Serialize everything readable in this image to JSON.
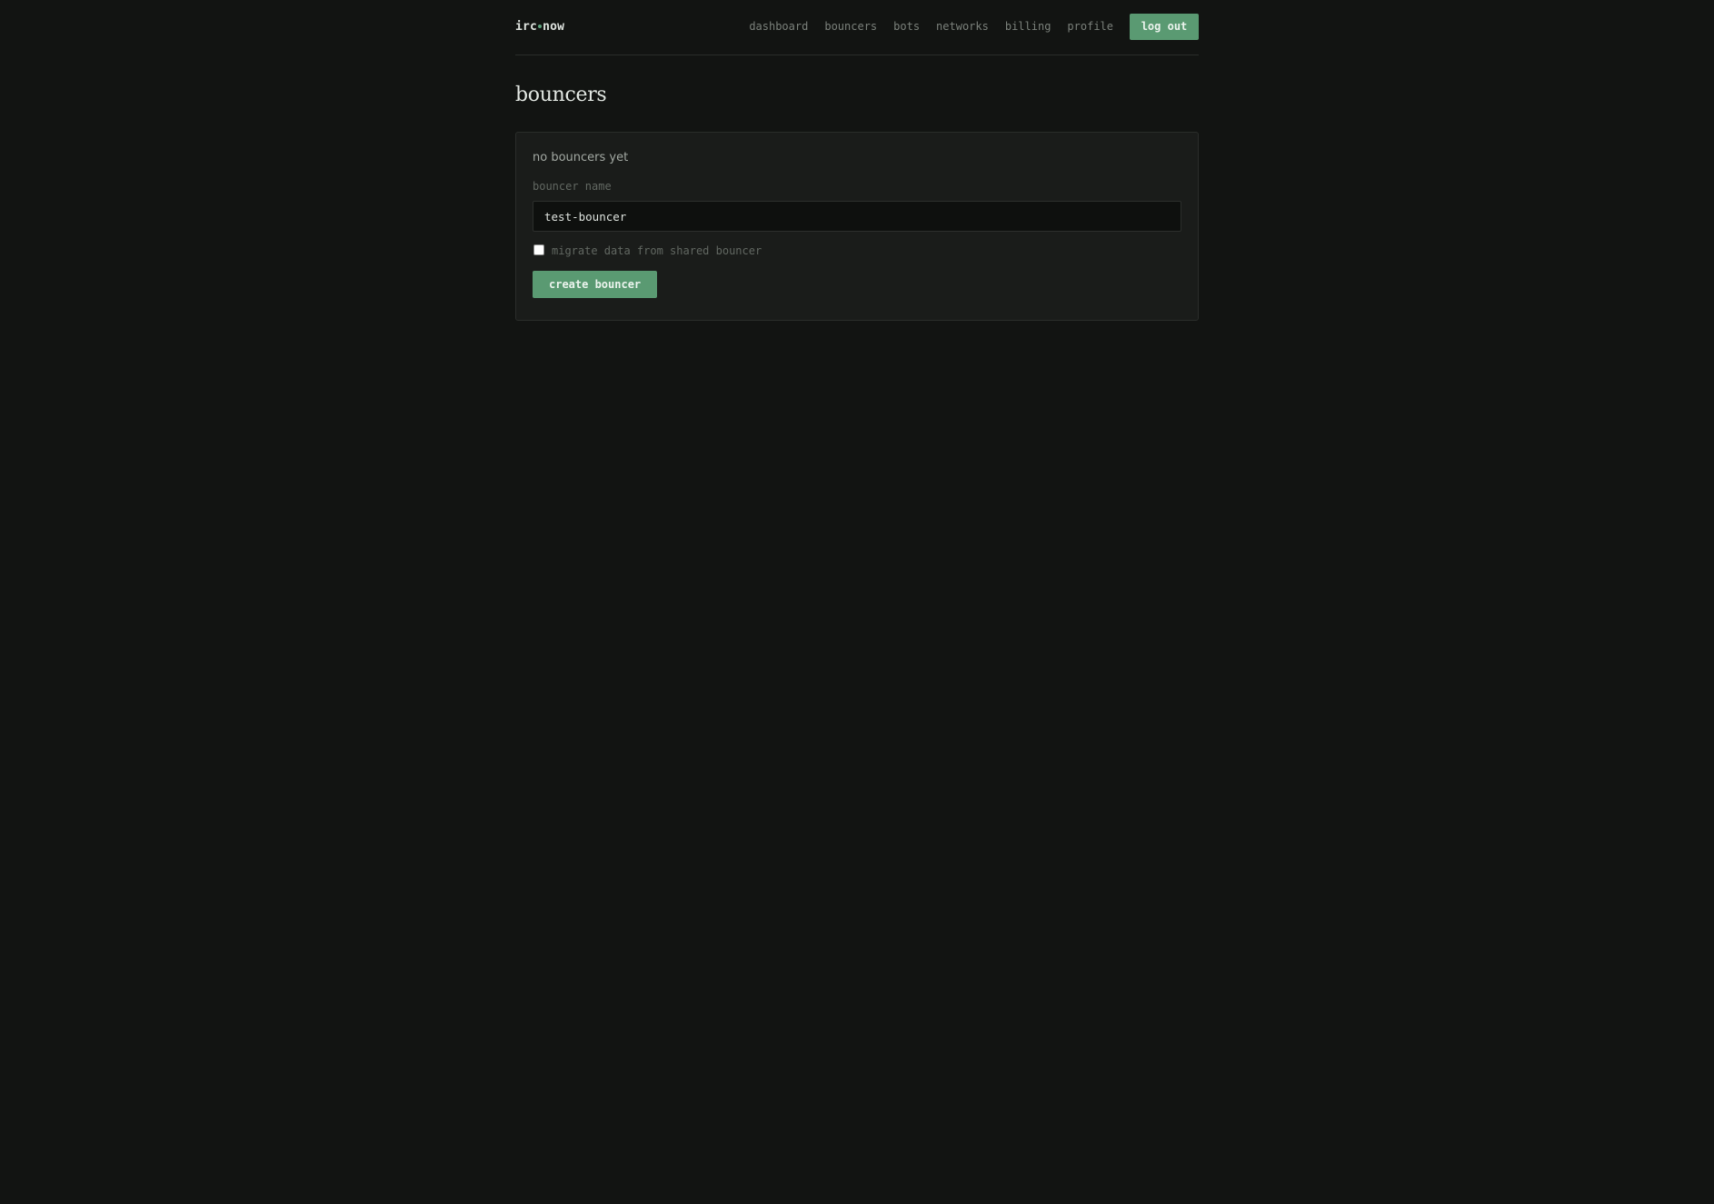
{
  "brand": {
    "left": "irc",
    "right": "now",
    "dot_color": "#5ea57d"
  },
  "nav": {
    "items": [
      "dashboard",
      "bouncers",
      "bots",
      "networks",
      "billing",
      "profile"
    ],
    "logout_label": "log out"
  },
  "page": {
    "title": "bouncers"
  },
  "card": {
    "empty_text": "no bouncers yet",
    "name_label": "bouncer name",
    "name_value": "test-bouncer",
    "migrate_label": "migrate data from shared bouncer",
    "migrate_checked": false,
    "create_label": "create bouncer"
  },
  "colors": {
    "background": "#121412",
    "accent": "#5a9a72",
    "card": "#1a1c1a"
  }
}
